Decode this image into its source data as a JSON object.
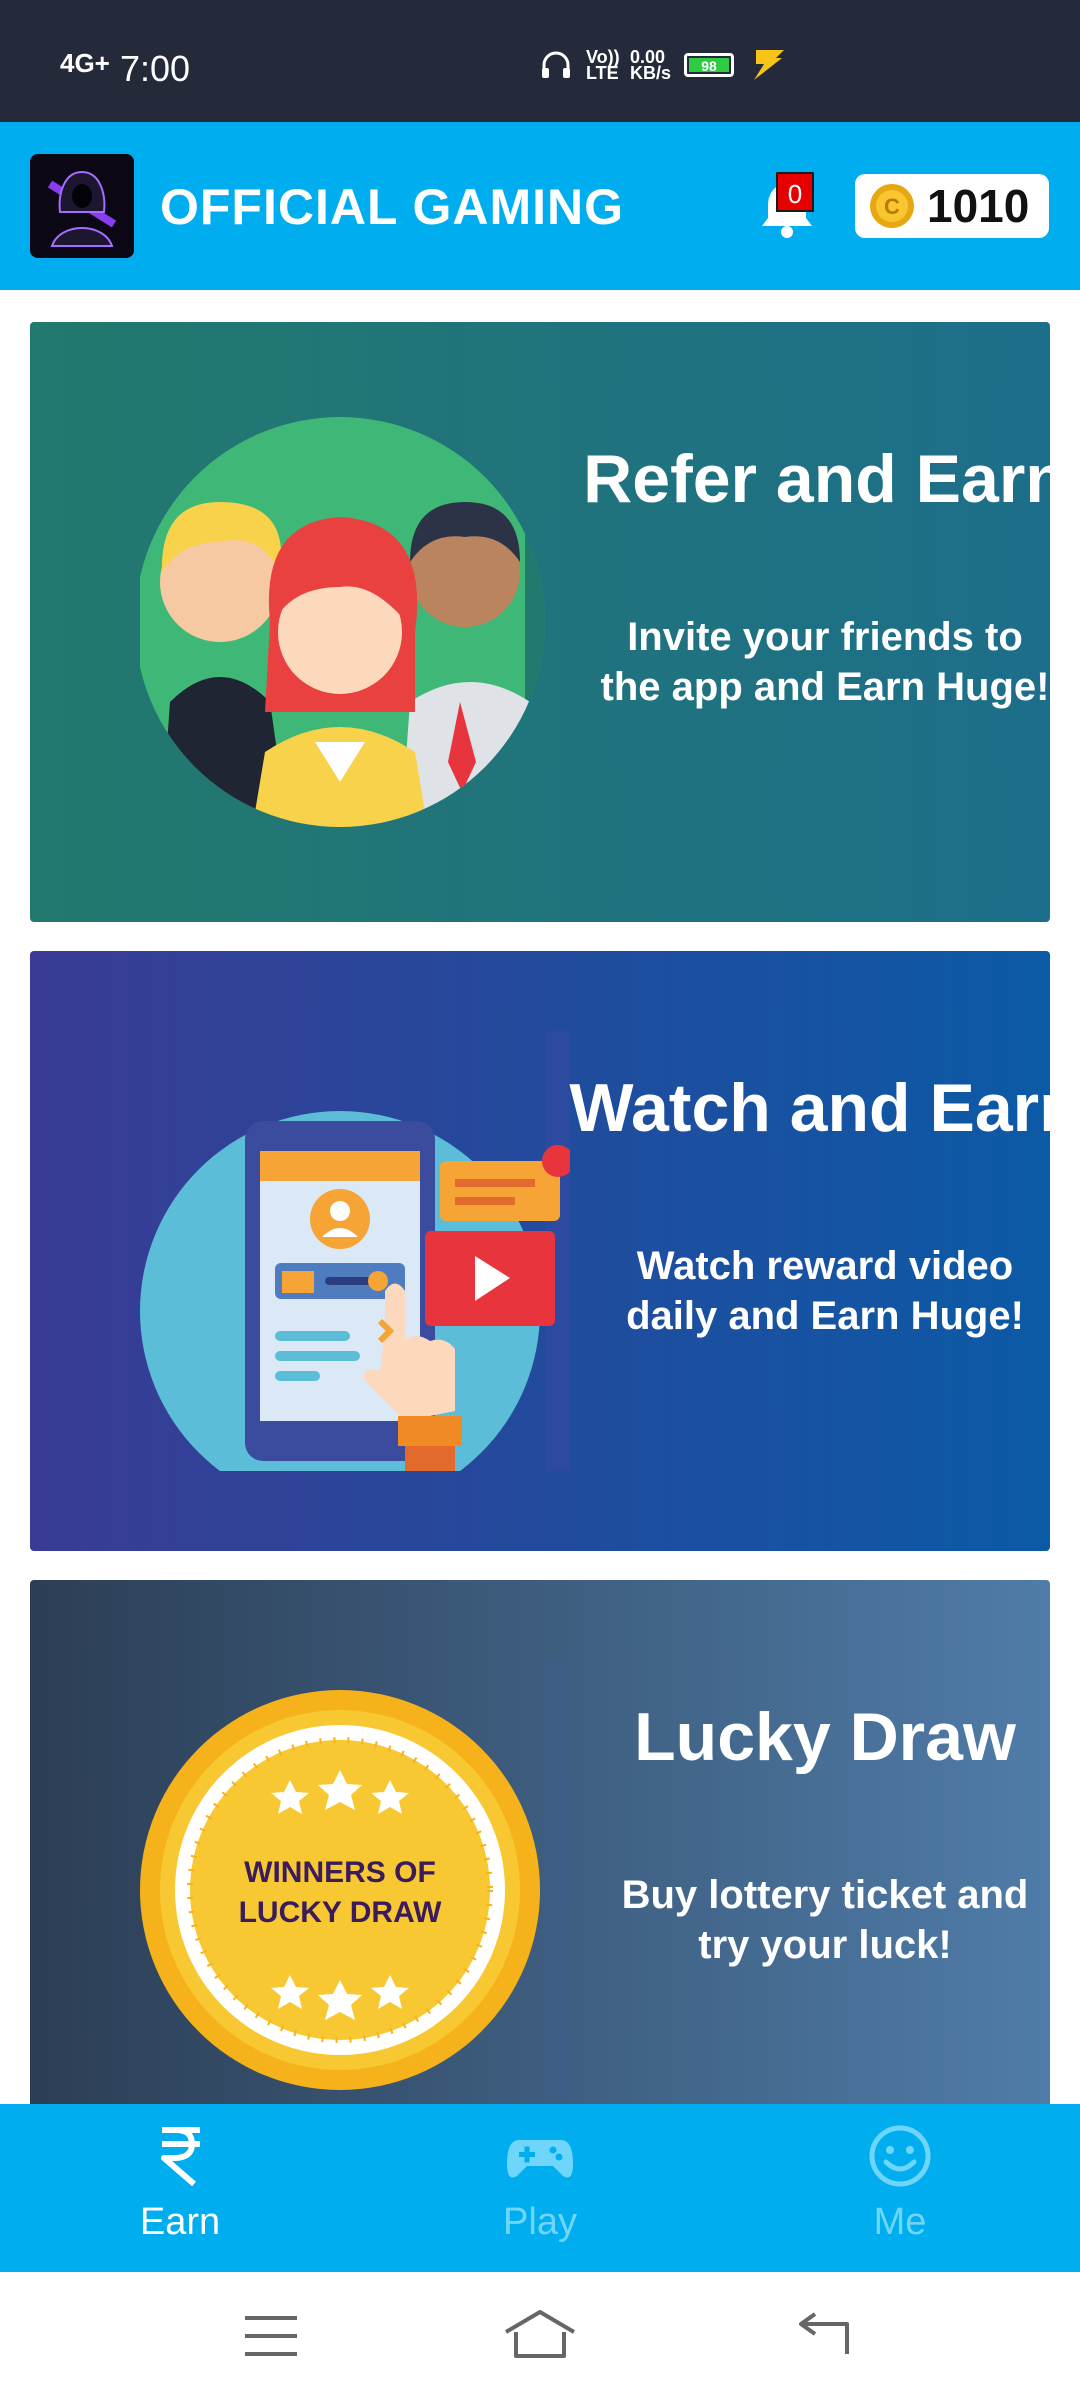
{
  "status_bar": {
    "network": "4G+",
    "time": "7:00",
    "volte": "Vo)) LTE",
    "speed": "0.00 KB/s",
    "battery": "98"
  },
  "app_bar": {
    "title": "OFFICIAL GAMING",
    "notification_count": "0",
    "coin_balance": "1010"
  },
  "cards": [
    {
      "title": "Refer and Earn",
      "subtitle_line1": "Invite your friends to",
      "subtitle_line2": "the app and Earn Huge!"
    },
    {
      "title": "Watch and Earn",
      "subtitle_line1": "Watch reward video",
      "subtitle_line2": "daily and Earn Huge!"
    },
    {
      "title": "Lucky Draw",
      "subtitle_line1": "Buy lottery ticket and",
      "subtitle_line2": "try your luck!",
      "badge_line1": "WINNERS OF",
      "badge_line2": "LUCKY DRAW"
    }
  ],
  "bottom_nav": [
    {
      "label": "Earn",
      "icon": "rupee-icon",
      "active": true
    },
    {
      "label": "Play",
      "icon": "gamepad-icon",
      "active": false
    },
    {
      "label": "Me",
      "icon": "smiley-icon",
      "active": false
    }
  ],
  "colors": {
    "accent": "#00aeef",
    "status_bar": "#252a3a",
    "nav_active": "#ffffff",
    "nav_inactive": "#6fd6fb"
  }
}
